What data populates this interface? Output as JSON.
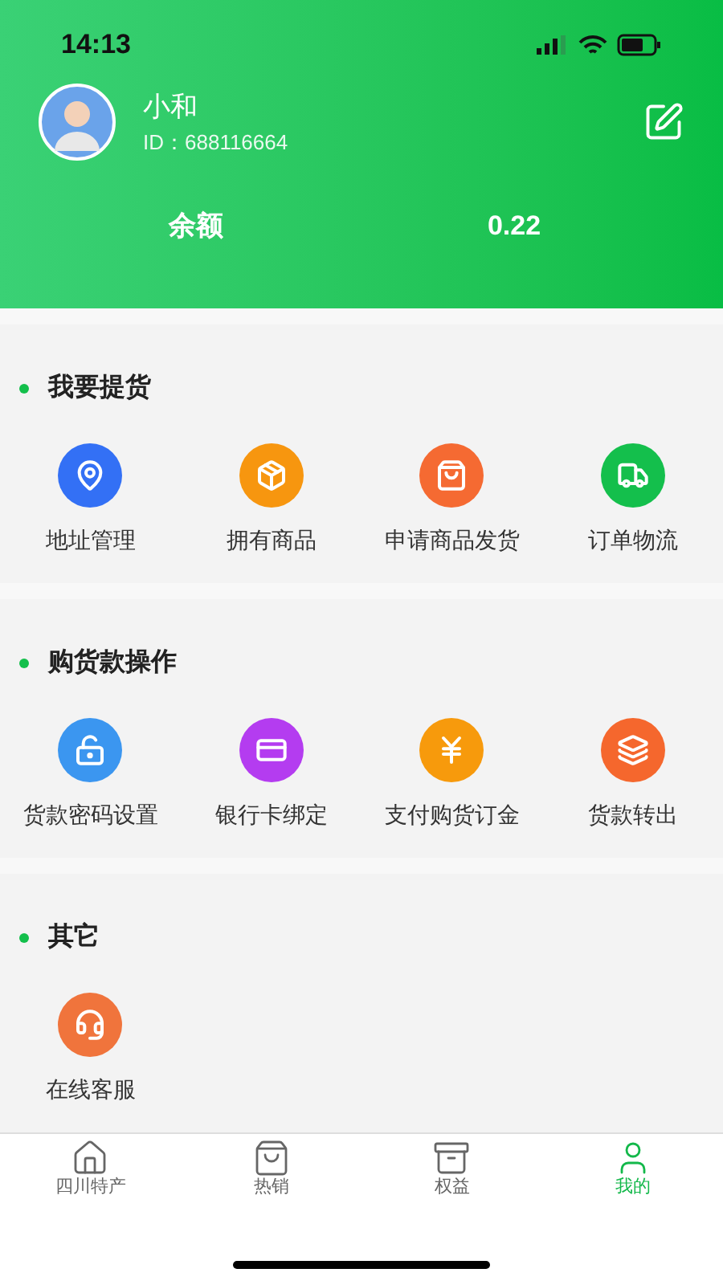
{
  "status_bar": {
    "time": "14:13"
  },
  "profile": {
    "name": "小和",
    "id": "ID：688116664"
  },
  "balance": {
    "label": "余额",
    "value": "0.22"
  },
  "sections": [
    {
      "title": "我要提货",
      "items": [
        {
          "label": "地址管理",
          "color": "#3370f5"
        },
        {
          "label": "拥有商品",
          "color": "#f7960f"
        },
        {
          "label": "申请商品发货",
          "color": "#f56a32"
        },
        {
          "label": "订单物流",
          "color": "#14bf4c"
        }
      ]
    },
    {
      "title": "购货款操作",
      "items": [
        {
          "label": "货款密码设置",
          "color": "#3b96f0"
        },
        {
          "label": "银行卡绑定",
          "color": "#b43cf0"
        },
        {
          "label": "支付购货订金",
          "color": "#f79a0c"
        },
        {
          "label": "货款转出",
          "color": "#f5672d"
        }
      ]
    },
    {
      "title": "其它",
      "items": [
        {
          "label": "在线客服",
          "color": "#f0743c"
        }
      ]
    }
  ],
  "tabs": [
    {
      "label": "四川特产",
      "selected": false
    },
    {
      "label": "热销",
      "selected": false
    },
    {
      "label": "权益",
      "selected": false
    },
    {
      "label": "我的",
      "selected": true
    }
  ]
}
